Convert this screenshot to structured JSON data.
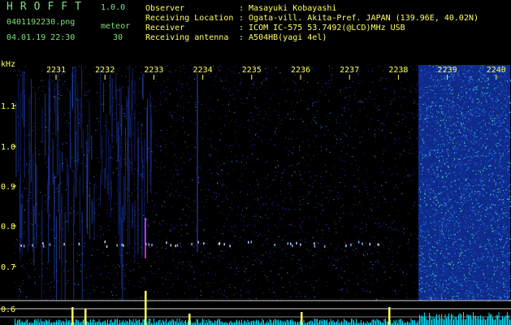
{
  "header": {
    "app_name": "HROFFT",
    "version": "1.0.0",
    "filename": "0401192230.png",
    "datetime": "04.01.19 22:30",
    "meteor_label": "meteor",
    "meteor_count": "30",
    "fields": [
      {
        "label": "Observer",
        "value": ": Masayuki Kobayashi"
      },
      {
        "label": "Receiving Location",
        "value": ": Ogata-vill. Akita-Pref. JAPAN (139.96E, 40.02N)"
      },
      {
        "label": "Receiver",
        "value": ": ICOM IC-575 53.7492(@LCD)MHz USB"
      },
      {
        "label": "Receiving antenna",
        "value": ": A504HB(yagi 4el)"
      }
    ]
  },
  "chart_data": {
    "type": "heatmap",
    "y_axis_unit": "kHz",
    "y_ticks": [
      "1.1",
      "1.0",
      "0.9",
      "0.8",
      "0.7",
      "0.6"
    ],
    "time_ticks": [
      "2231",
      "2232",
      "2233",
      "2234",
      "2235",
      "2236",
      "2237",
      "2238",
      "2239",
      "2240"
    ]
  },
  "colors": {
    "header_green": "#7fe07f",
    "header_yellow": "#ffff66",
    "axis_yellow": "#ffff55",
    "signal_blue": "#1e3cc8",
    "level_cyan": "#00e0ff"
  }
}
